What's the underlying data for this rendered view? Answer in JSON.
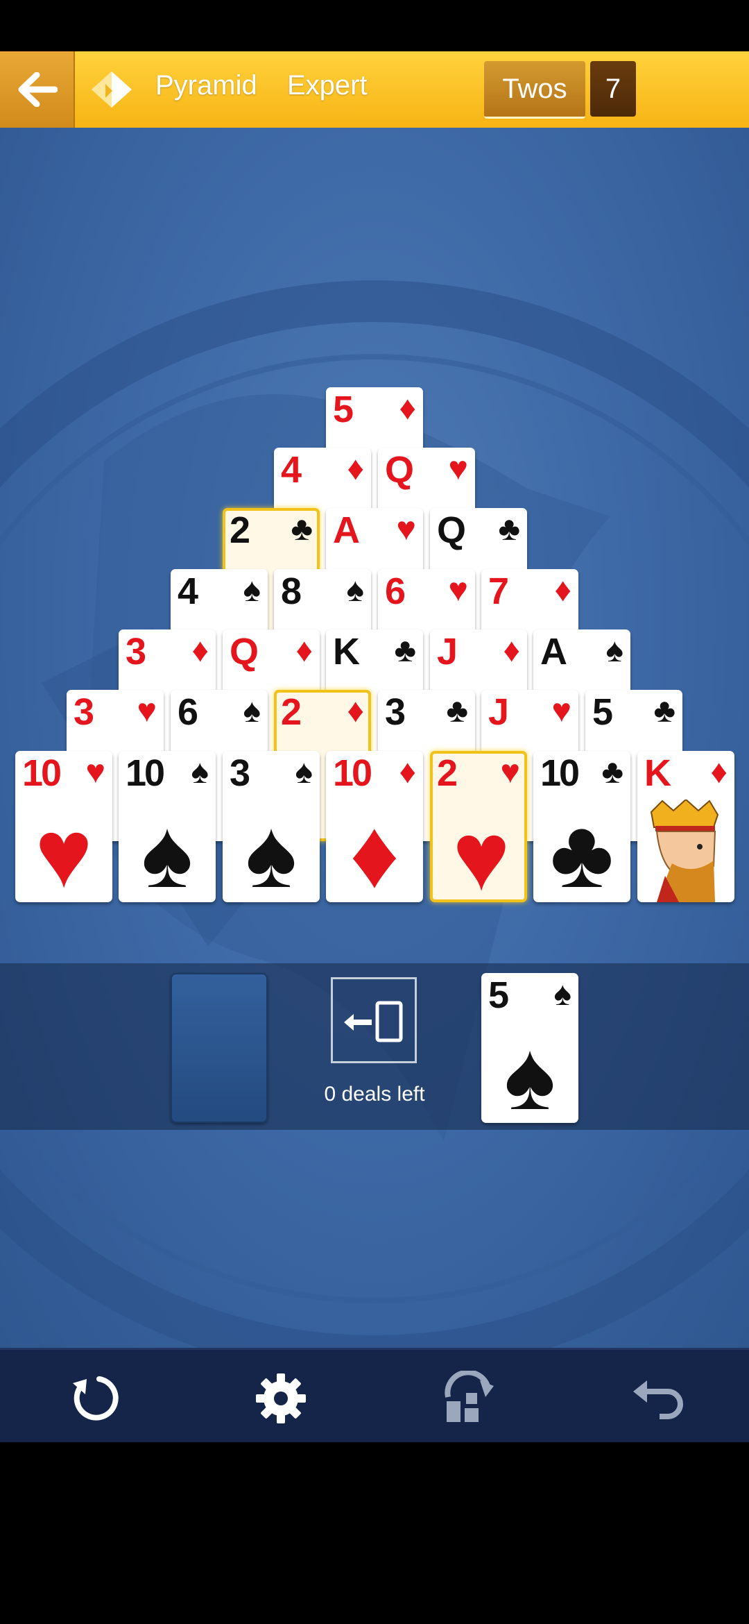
{
  "header": {
    "game_name": "Pyramid",
    "difficulty": "Expert",
    "mode": "Twos",
    "count": "7"
  },
  "pyramid": [
    {
      "rank": "5",
      "suit": "♦",
      "color": "red"
    },
    {
      "rank": "4",
      "suit": "♦",
      "color": "red"
    },
    {
      "rank": "Q",
      "suit": "♥",
      "color": "red",
      "face": true
    },
    {
      "rank": "2",
      "suit": "♣",
      "color": "black",
      "highlight": true
    },
    {
      "rank": "A",
      "suit": "♥",
      "color": "red"
    },
    {
      "rank": "Q",
      "suit": "♣",
      "color": "black",
      "face": true
    },
    {
      "rank": "4",
      "suit": "♠",
      "color": "black"
    },
    {
      "rank": "8",
      "suit": "♠",
      "color": "black"
    },
    {
      "rank": "6",
      "suit": "♥",
      "color": "red"
    },
    {
      "rank": "7",
      "suit": "♦",
      "color": "red"
    },
    {
      "rank": "3",
      "suit": "♦",
      "color": "red"
    },
    {
      "rank": "Q",
      "suit": "♦",
      "color": "red",
      "face": true
    },
    {
      "rank": "K",
      "suit": "♣",
      "color": "black",
      "face": true
    },
    {
      "rank": "J",
      "suit": "♦",
      "color": "red",
      "face": true
    },
    {
      "rank": "A",
      "suit": "♠",
      "color": "black"
    },
    {
      "rank": "3",
      "suit": "♥",
      "color": "red"
    },
    {
      "rank": "6",
      "suit": "♠",
      "color": "black"
    },
    {
      "rank": "2",
      "suit": "♦",
      "color": "red",
      "highlight": true
    },
    {
      "rank": "3",
      "suit": "♣",
      "color": "black"
    },
    {
      "rank": "J",
      "suit": "♥",
      "color": "red",
      "face": true
    },
    {
      "rank": "5",
      "suit": "♣",
      "color": "black"
    },
    {
      "rank": "10",
      "suit": "♥",
      "color": "red"
    },
    {
      "rank": "10",
      "suit": "♠",
      "color": "black"
    },
    {
      "rank": "3",
      "suit": "♠",
      "color": "black"
    },
    {
      "rank": "10",
      "suit": "♦",
      "color": "red"
    },
    {
      "rank": "2",
      "suit": "♥",
      "color": "red",
      "highlight": true
    },
    {
      "rank": "10",
      "suit": "♣",
      "color": "black"
    },
    {
      "rank": "K",
      "suit": "♦",
      "color": "red",
      "face": true
    }
  ],
  "stock": {
    "deals_left_label": "0 deals left"
  },
  "waste": {
    "rank": "5",
    "suit": "♠",
    "color": "black"
  },
  "toolbar": {
    "icons": [
      "restart-icon",
      "settings-icon",
      "hint-icon",
      "undo-icon"
    ]
  },
  "colors": {
    "header": "#f7b414",
    "board": "#3e6aa7",
    "card_red": "#e4151c",
    "highlight": "#f0c21a",
    "toolbar": "#15254a"
  }
}
